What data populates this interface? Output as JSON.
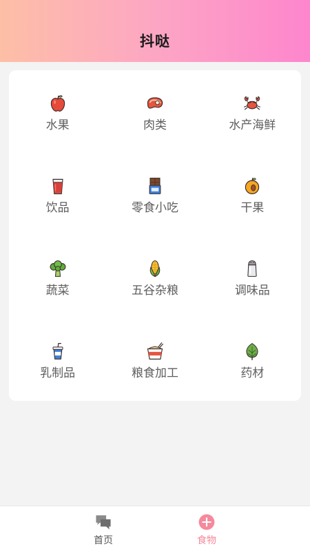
{
  "header": {
    "title": "抖哒"
  },
  "categories": [
    {
      "label": "水果",
      "icon": "apple-icon"
    },
    {
      "label": "肉类",
      "icon": "steak-icon"
    },
    {
      "label": "水产海鲜",
      "icon": "crab-icon"
    },
    {
      "label": "饮品",
      "icon": "juice-icon"
    },
    {
      "label": "零食小吃",
      "icon": "chocolate-icon"
    },
    {
      "label": "干果",
      "icon": "apricot-icon"
    },
    {
      "label": "蔬菜",
      "icon": "broccoli-icon"
    },
    {
      "label": "五谷杂粮",
      "icon": "corn-icon"
    },
    {
      "label": "调味品",
      "icon": "salt-shaker-icon"
    },
    {
      "label": "乳制品",
      "icon": "yogurt-icon"
    },
    {
      "label": "粮食加工",
      "icon": "noodle-bowl-icon"
    },
    {
      "label": "药材",
      "icon": "artichoke-icon"
    }
  ],
  "tabbar": {
    "home_label": "首页",
    "food_label": "食物",
    "active_color": "#f48a9c",
    "inactive_color": "#555555"
  },
  "colors": {
    "header_gradient": [
      "#fdbfa6",
      "#fd86cd"
    ],
    "background": "#f3f3f3"
  }
}
